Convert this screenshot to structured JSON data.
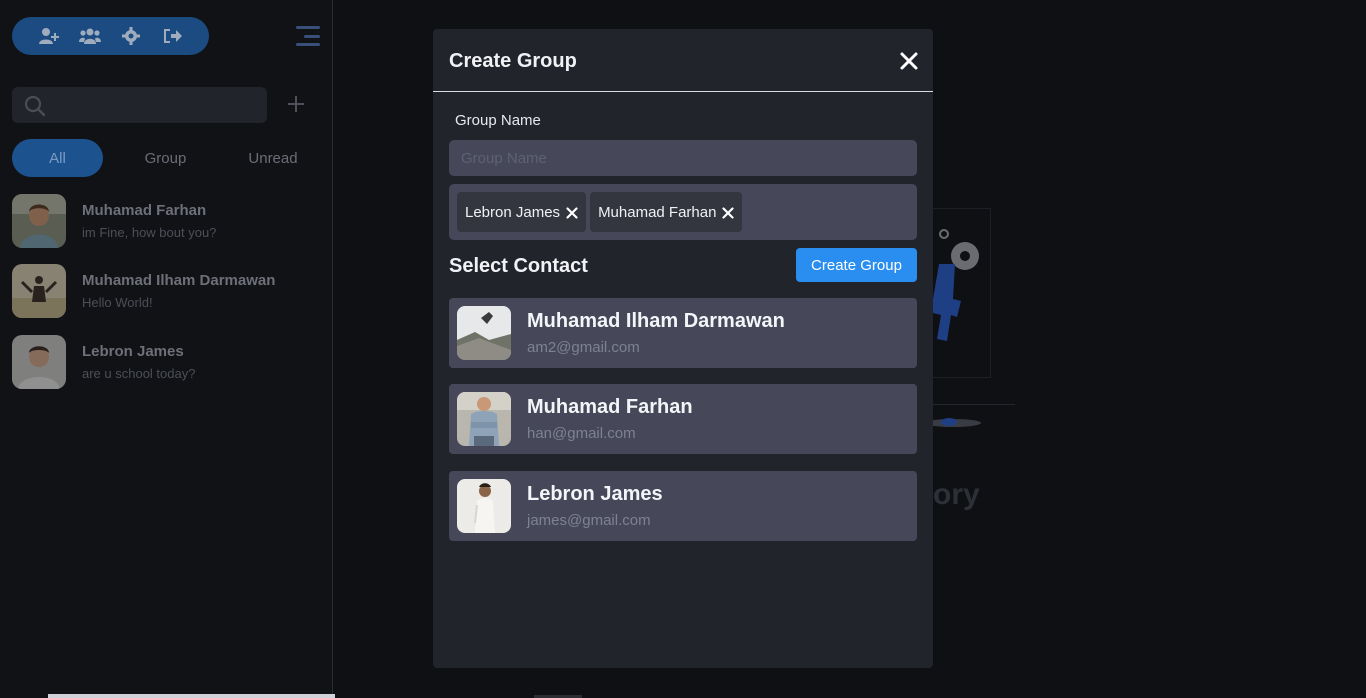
{
  "sidebar": {
    "toolbar": {
      "icons": [
        "add-user-icon",
        "users-group-icon",
        "gear-icon",
        "logout-icon"
      ]
    },
    "search": {
      "placeholder": ""
    },
    "filters": [
      {
        "label": "All",
        "active": true
      },
      {
        "label": "Group",
        "active": false
      },
      {
        "label": "Unread",
        "active": false
      }
    ],
    "chats": [
      {
        "name": "Muhamad Farhan",
        "message": "im Fine, how bout you?"
      },
      {
        "name": "Muhamad Ilham Darmawan",
        "message": "Hello World!"
      },
      {
        "name": "Lebron James",
        "message": "are u school today?"
      }
    ]
  },
  "background": {
    "partial_text": "ory"
  },
  "modal": {
    "title": "Create Group",
    "group_name_label": "Group Name",
    "group_name_placeholder": "Group Name",
    "group_name_value": "",
    "selected_chips": [
      {
        "label": "Lebron James"
      },
      {
        "label": "Muhamad Farhan"
      }
    ],
    "select_contact_title": "Select Contact",
    "create_button_label": "Create Group",
    "contacts": [
      {
        "name": "Muhamad Ilham Darmawan",
        "email": "am2@gmail.com"
      },
      {
        "name": "Muhamad Farhan",
        "email": "han@gmail.com"
      },
      {
        "name": "Lebron James",
        "email": "james@gmail.com"
      }
    ]
  },
  "colors": {
    "accent": "#2a8ef0",
    "sidebar_accent": "#1f5fa5",
    "modal_bg": "#22242c",
    "card_bg": "#464859"
  }
}
